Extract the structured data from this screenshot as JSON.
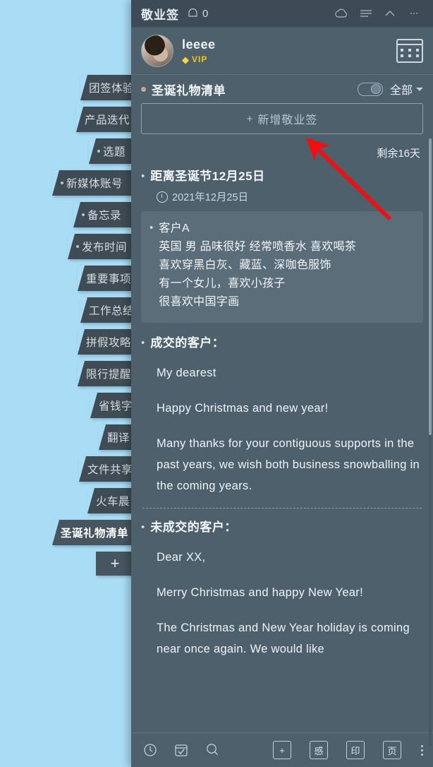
{
  "app": {
    "brand": "敬业签",
    "notification_count": "0",
    "titlebar_icons": [
      "cloud-sync-icon",
      "list-menu-icon",
      "collapse-up-icon",
      "minimize-icon"
    ]
  },
  "user": {
    "name": "leeee",
    "vip_label": "VIP",
    "calendar_button": "calendar-icon"
  },
  "list_header": {
    "title": "圣诞礼物清单",
    "toggle_state": "off",
    "filter_label": "全部"
  },
  "add_button": {
    "label": "新增敬业签",
    "plus": "+"
  },
  "remaining": "剩余16天",
  "notes": [
    {
      "title": "距离圣诞节12月25日",
      "time": "2021年12月25日"
    },
    {
      "title": "客户A",
      "lines": [
        "英国 男 品味很好 经常喷香水 喜欢喝茶",
        "喜欢穿黑白灰、藏蓝、深咖色服饰",
        "有一个女儿，喜欢小孩子",
        "很喜欢中国字画"
      ]
    },
    {
      "title": "成交的客户：",
      "lines": [
        "My dearest",
        "Happy Christmas and new year!",
        "Many thanks for your contiguous supports in the past years, we wish both business snowballing in the coming years."
      ]
    },
    {
      "title": "未成交的客户：",
      "lines": [
        "Dear XX,",
        "Merry Christmas and happy New Year!",
        "The Christmas and New Year holiday is coming near once again. We would like"
      ]
    }
  ],
  "categories": [
    {
      "label": "团签体验",
      "active": false,
      "dot": false,
      "indent": 114
    },
    {
      "label": "产品迭代",
      "active": false,
      "dot": false,
      "indent": 108
    },
    {
      "label": "选题",
      "active": false,
      "dot": true,
      "indent": 126
    },
    {
      "label": "新媒体账号",
      "active": false,
      "dot": true,
      "indent": 74
    },
    {
      "label": "备忘录",
      "active": false,
      "dot": true,
      "indent": 104
    },
    {
      "label": "发布时间",
      "active": false,
      "dot": true,
      "indent": 96
    },
    {
      "label": "重要事项",
      "active": false,
      "dot": false,
      "indent": 110
    },
    {
      "label": "工作总结",
      "active": false,
      "dot": false,
      "indent": 114
    },
    {
      "label": "拼假攻略",
      "active": false,
      "dot": false,
      "indent": 110
    },
    {
      "label": "限行提醒",
      "active": false,
      "dot": false,
      "indent": 110
    },
    {
      "label": "省钱字",
      "active": false,
      "dot": false,
      "indent": 128
    },
    {
      "label": "翻译",
      "active": false,
      "dot": false,
      "indent": 140
    },
    {
      "label": "文件共享",
      "active": false,
      "dot": false,
      "indent": 112
    },
    {
      "label": "火车晨",
      "active": false,
      "dot": false,
      "indent": 124
    },
    {
      "label": "圣诞礼物清单",
      "active": true,
      "dot": false,
      "indent": 74
    }
  ],
  "category_add": "+",
  "bottom_bar": {
    "left_icons": [
      "clock-icon",
      "checkbox-calendar-icon",
      "search-icon"
    ],
    "right_buttons": [
      "+",
      "感",
      "印",
      "页"
    ],
    "more": "kebab-more-icon"
  },
  "colors": {
    "desktop_bg": "#a9dcf5",
    "panel_bg": "#4e606c",
    "titlebar_bg": "#3c4b56",
    "card_bg": "#5b6d79",
    "accent_vip": "#f0c419",
    "arrow": "#ee1111"
  }
}
